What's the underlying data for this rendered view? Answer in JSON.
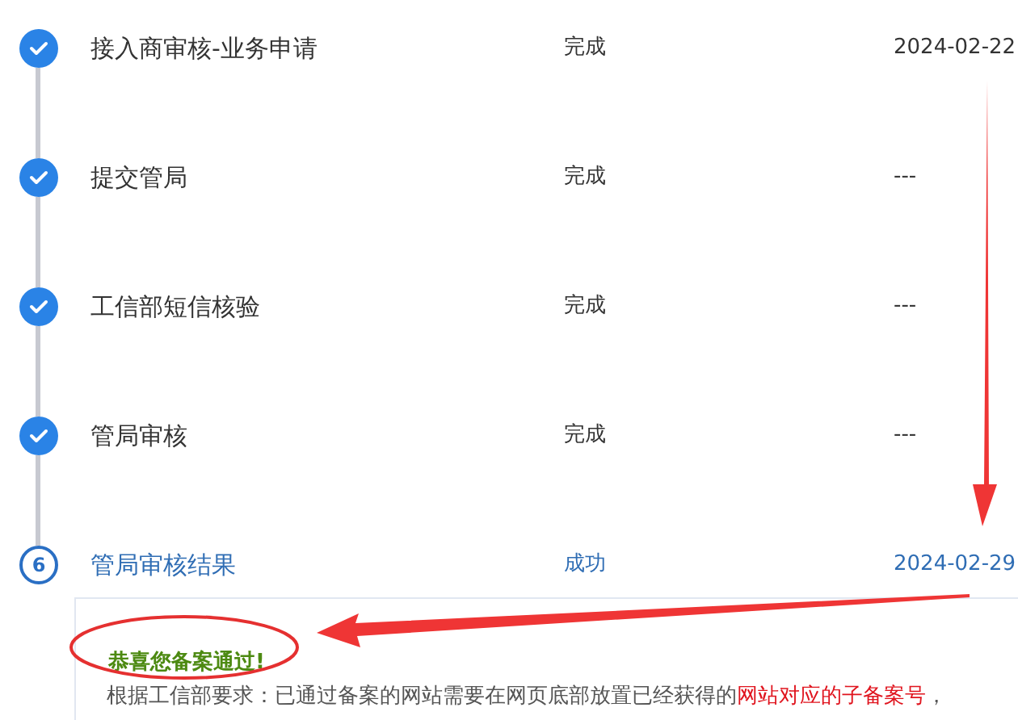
{
  "steps": [
    {
      "kind": "done",
      "title": "接入商审核-业务申请",
      "status": "完成",
      "date": "2024-02-22"
    },
    {
      "kind": "done",
      "title": "提交管局",
      "status": "完成",
      "date": "---"
    },
    {
      "kind": "done",
      "title": "工信部短信核验",
      "status": "完成",
      "date": "---"
    },
    {
      "kind": "done",
      "title": "管局审核",
      "status": "完成",
      "date": "---"
    },
    {
      "kind": "current",
      "number": "6",
      "title": "管局审核结果",
      "status": "成功",
      "date": "2024-02-29"
    }
  ],
  "notice": {
    "title": "恭喜您备案通过!",
    "body": [
      {
        "text": "根据工信部要求：已通过备案的网站需要在网页底部放置已经获得的",
        "highlight": false
      },
      {
        "text": "网站对应的子备案号",
        "highlight": true
      },
      {
        "text": "，",
        "highlight": false
      }
    ]
  }
}
